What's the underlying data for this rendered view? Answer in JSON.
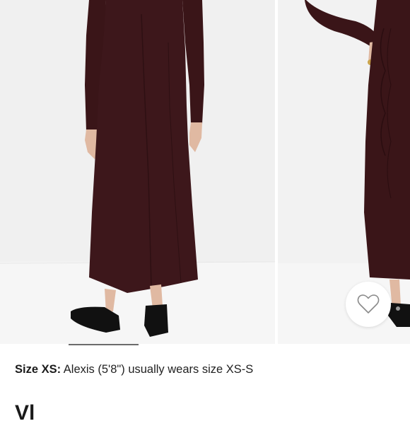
{
  "gallery": {
    "images": [
      {
        "name": "product-photo-back-view",
        "icon": "dress-back-view-photo"
      },
      {
        "name": "product-photo-side-view",
        "icon": "dress-side-view-photo"
      }
    ],
    "current_index": 0,
    "progress_fraction": 0.17,
    "wishlist_icon": "heart-outline-icon",
    "colors": {
      "background": "#f1f1f1",
      "dress": "#3a1518",
      "progress": "#6b6b6b"
    }
  },
  "size_info": {
    "label": "Size XS:",
    "text": " Alexis (5'8\") usually wears size XS-S"
  },
  "next_section": {
    "heading": "Vl"
  }
}
